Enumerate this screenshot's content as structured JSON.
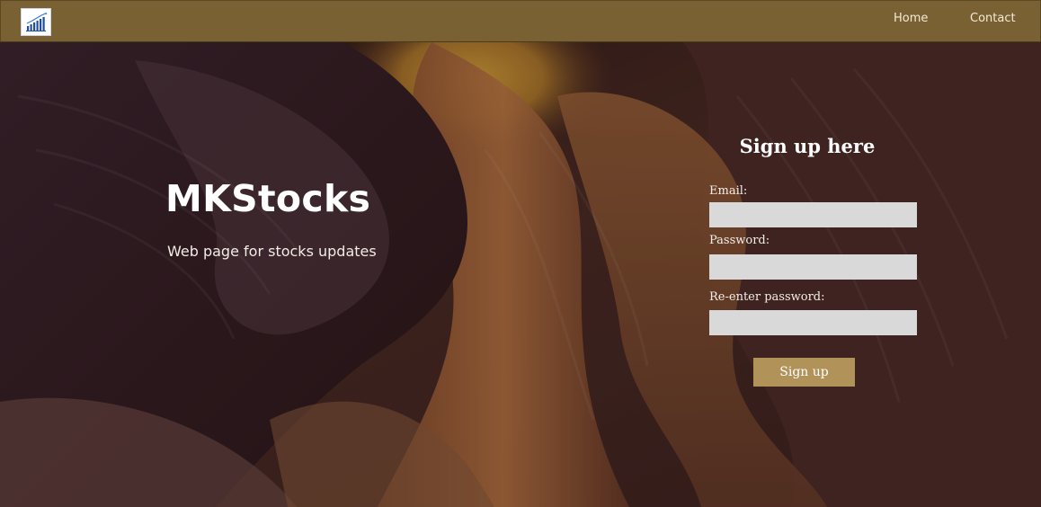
{
  "navbar": {
    "logo_icon": "chart-bars-icon",
    "links": [
      {
        "label": "Home"
      },
      {
        "label": "Contact"
      }
    ],
    "background": "#7a6134"
  },
  "hero": {
    "title": "MKStocks",
    "subtitle": "Web page for stocks updates"
  },
  "signup": {
    "heading": "Sign up here",
    "fields": [
      {
        "label": "Email:",
        "value": "",
        "placeholder": ""
      },
      {
        "label": "Password:",
        "value": "",
        "placeholder": ""
      },
      {
        "label": "Re-enter password:",
        "value": "",
        "placeholder": ""
      }
    ],
    "button_label": "Sign up",
    "button_color": "#b1935a"
  }
}
